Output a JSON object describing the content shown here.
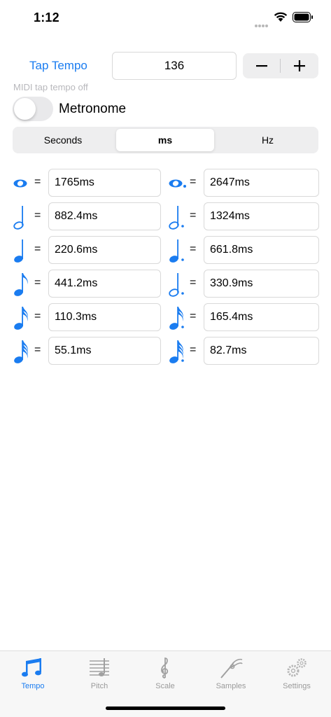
{
  "status": {
    "time": "1:12"
  },
  "tempo": {
    "tap_label": "Tap Tempo",
    "bpm": "136",
    "midi_note": "MIDI tap tempo off",
    "metronome_label": "Metronome",
    "metronome_on": false
  },
  "units": {
    "options": [
      "Seconds",
      "ms",
      "Hz"
    ],
    "selected": "ms"
  },
  "rows": [
    {
      "left": {
        "icon": "whole-note-icon",
        "value": "1765ms"
      },
      "right": {
        "icon": "dotted-whole-note-icon",
        "value": "2647ms"
      }
    },
    {
      "left": {
        "icon": "half-note-icon",
        "value": "882.4ms"
      },
      "right": {
        "icon": "dotted-half-note-icon",
        "value": "1324ms"
      }
    },
    {
      "left": {
        "icon": "quarter-note-icon",
        "value": "220.6ms"
      },
      "right": {
        "icon": "dotted-quarter-note-icon",
        "value": "661.8ms"
      }
    },
    {
      "left": {
        "icon": "eighth-note-icon",
        "value": "441.2ms"
      },
      "right": {
        "icon": "dotted-half-note-icon",
        "value": "330.9ms"
      }
    },
    {
      "left": {
        "icon": "sixteenth-note-icon",
        "value": "110.3ms"
      },
      "right": {
        "icon": "dotted-sixteenth-note-icon",
        "value": "165.4ms"
      }
    },
    {
      "left": {
        "icon": "thirty-second-note-icon",
        "value": "55.1ms"
      },
      "right": {
        "icon": "dotted-thirty-second-note-icon",
        "value": "82.7ms"
      }
    }
  ],
  "equals_sign": "=",
  "tabs": [
    {
      "label": "Tempo",
      "icon": "notes-icon",
      "active": true
    },
    {
      "label": "Pitch",
      "icon": "staff-icon",
      "active": false
    },
    {
      "label": "Scale",
      "icon": "treble-clef-icon",
      "active": false
    },
    {
      "label": "Samples",
      "icon": "tuning-fork-icon",
      "active": false
    },
    {
      "label": "Settings",
      "icon": "gears-icon",
      "active": false
    }
  ],
  "colors": {
    "accent": "#1a7cf0",
    "inactive": "#9a9a9a"
  }
}
